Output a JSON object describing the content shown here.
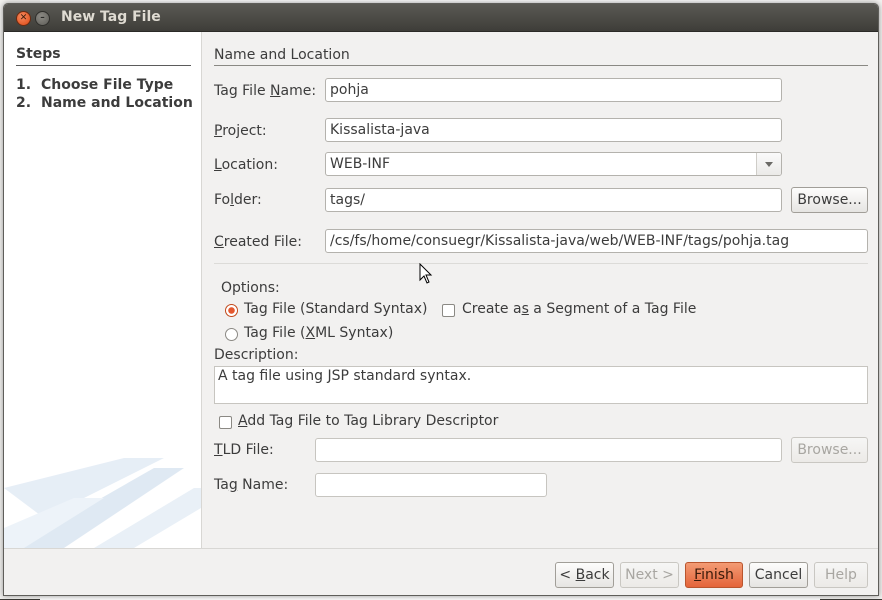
{
  "window": {
    "title": "New Tag File"
  },
  "steps": {
    "title": "Steps",
    "items": [
      {
        "num": "1.",
        "label": "Choose File Type"
      },
      {
        "num": "2.",
        "label": "Name and Location"
      }
    ]
  },
  "section": {
    "title": "Name and Location"
  },
  "form": {
    "tag_file_name": {
      "label_pre": "Tag File ",
      "label_u": "N",
      "label_post": "ame:",
      "value": "pohja"
    },
    "project": {
      "label_u": "P",
      "label_post": "roject:",
      "value": "Kissalista-java"
    },
    "location": {
      "label_u": "L",
      "label_post": "ocation:",
      "value": "WEB-INF"
    },
    "folder": {
      "label_pre": "Fo",
      "label_u": "l",
      "label_post": "der:",
      "value": "tags/",
      "browse": "Browse..."
    },
    "created_file": {
      "label_u": "C",
      "label_post": "reated File:",
      "value": "/cs/fs/home/consuegr/Kissalista-java/web/WEB-INF/tags/pohja.tag"
    }
  },
  "options": {
    "title": "Options:",
    "standard": {
      "label": "Tag File (Standard Syntax)",
      "checked": true
    },
    "xml": {
      "label_pre": "Tag File (",
      "label_u": "X",
      "label_post": "ML Syntax)",
      "checked": false
    },
    "segment": {
      "label_pre": "Create a",
      "label_u": "s",
      "label_post": " a Segment of a Tag File",
      "checked": false
    }
  },
  "description": {
    "label": "Description:",
    "text": "A tag file using JSP standard syntax."
  },
  "tld": {
    "add_label_pre": "",
    "add_label_u": "A",
    "add_label_post": "dd Tag File to Tag Library Descriptor",
    "add_checked": false,
    "file_label_u": "T",
    "file_label_post": "LD File:",
    "file_value": "",
    "browse": "Browse...",
    "tag_name_label_pre": "Ta",
    "tag_name_label_u": "g",
    "tag_name_label_post": " Name:",
    "tag_name_value": ""
  },
  "buttons": {
    "back": {
      "pre": "< ",
      "u": "B",
      "post": "ack"
    },
    "next": "Next >",
    "finish": {
      "u": "F",
      "post": "inish"
    },
    "cancel": "Cancel",
    "help": "Help"
  },
  "colors": {
    "accent": "#e4643a",
    "titlebar": "#3e3d39"
  }
}
